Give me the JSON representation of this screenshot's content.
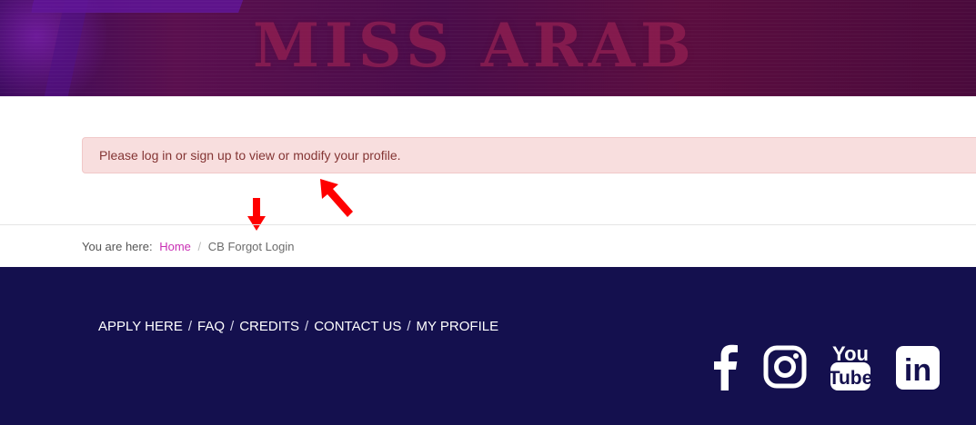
{
  "banner": {
    "text": "MISS ARAB"
  },
  "alert": {
    "message": "Please log in or sign up to view or modify your profile."
  },
  "breadcrumb": {
    "prefix": "You are here:",
    "home": "Home",
    "separator": "/",
    "current": "CB Forgot Login"
  },
  "footer": {
    "links": [
      "APPLY HERE",
      "FAQ",
      "CREDITS",
      "CONTACT US",
      "MY PROFILE"
    ],
    "separator": "/",
    "social": [
      {
        "name": "facebook",
        "icon": "facebook-icon"
      },
      {
        "name": "instagram",
        "icon": "instagram-icon"
      },
      {
        "name": "youtube",
        "icon": "youtube-icon",
        "label_top": "You",
        "label_bottom": "Tube"
      },
      {
        "name": "linkedin",
        "icon": "linkedin-icon",
        "label": "in"
      }
    ]
  },
  "colors": {
    "footer_bg": "#14104e",
    "alert_bg": "#f8dede",
    "alert_text": "#843534",
    "link_accent": "#c930b4",
    "annotation_arrow": "#ff0000"
  }
}
